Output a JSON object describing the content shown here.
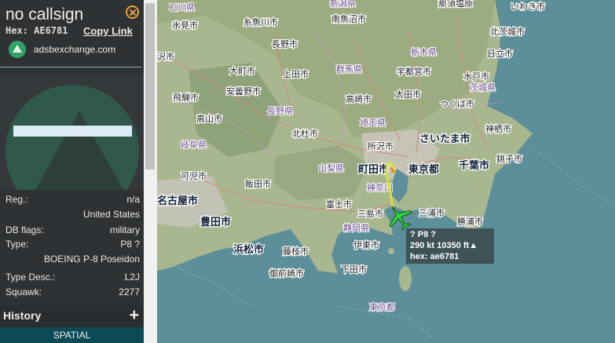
{
  "aircraft": {
    "callsign": "no callsign",
    "hex_label": "Hex: AE6781",
    "copy_link": "Copy Link",
    "site_link": "adsbexchange.com"
  },
  "details": {
    "reg_label": "Reg.:",
    "reg_value": "n/a",
    "country": "United States",
    "db_flags_label": "DB flags:",
    "db_flags_value": "military",
    "type_label": "Type:",
    "type_value": "P8 ?",
    "model": "BOEING P-8 Poseidon",
    "type_desc_label": "Type Desc.:",
    "type_desc_value": "L2J",
    "squawk_label": "Squawk:",
    "squawk_value": "2277"
  },
  "history": {
    "label": "History",
    "add": "+"
  },
  "spatial_tab": "SPATIAL",
  "map_label": {
    "line1": "?   P8 ?",
    "line2": "290 kt  10350 ft▲",
    "line3": "hex: ae6781"
  },
  "map_places": {
    "cities": [
      "石川県",
      "新潟県",
      "那須塩原",
      "いわき市",
      "氷見市",
      "糸魚川市",
      "南魚沼市",
      "北茨城市",
      "富山市",
      "長野市",
      "栃木県",
      "日立市",
      "大町市",
      "上田市",
      "群馬県",
      "宇都宮市",
      "水戸市",
      "飛騨市",
      "安曇野市",
      "高崎市",
      "太田市",
      "茨城県",
      "つくば市",
      "高山市",
      "長野県",
      "埼玉県",
      "神栖市",
      "岐阜県",
      "北杜市",
      "所沢市",
      "さいたま市",
      "銚子市",
      "山梨県",
      "町田市",
      "東京都",
      "千葉市",
      "可児市",
      "飯田市",
      "神奈川",
      "名古屋市",
      "富士市",
      "三島市",
      "三浦市",
      "豊田市",
      "勝浦市",
      "浜松市",
      "藤枝市",
      "伊東市",
      "静岡県",
      "御前崎市",
      "下田市",
      "東京都"
    ],
    "note": "map tiles"
  },
  "colors": {
    "sidebar_bg": "#2f3234",
    "accent_orange": "#e8a23b",
    "logo_green": "#2fa269",
    "spatial_bg": "#0c4b56",
    "track_yellow": "#d8e23c",
    "aircraft_green": "#2fd13a",
    "sea": "#5d8f9a"
  },
  "icons": [
    "close-icon",
    "adsbexchange-logo-icon",
    "plus-icon",
    "aircraft-icon"
  ]
}
